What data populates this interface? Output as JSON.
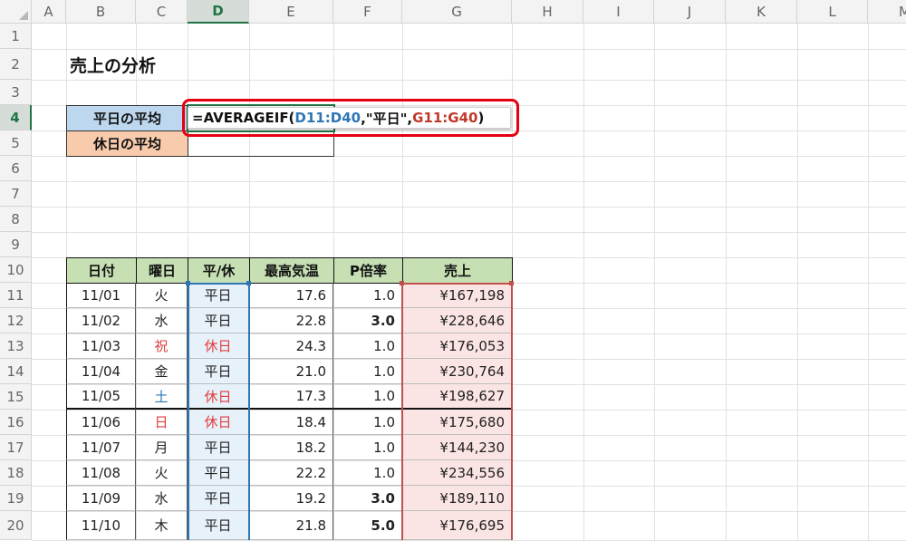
{
  "columns": [
    "A",
    "B",
    "C",
    "D",
    "E",
    "F",
    "G",
    "H",
    "I",
    "J",
    "K",
    "L",
    "M"
  ],
  "rows": [
    "1",
    "2",
    "3",
    "4",
    "5",
    "6",
    "7",
    "8",
    "9",
    "10",
    "11",
    "12",
    "13",
    "14",
    "15",
    "16",
    "17",
    "18",
    "19",
    "20"
  ],
  "title": "売上の分析",
  "summary": {
    "weekday_label": "平日の平均",
    "holiday_label": "休日の平均"
  },
  "formula": {
    "prefix": "=AVERAGEIF(",
    "range1": "D11:D40",
    "sep1": ",\"平日\",",
    "range2": "G11:G40",
    "suffix": ")"
  },
  "table": {
    "headers": [
      "日付",
      "曜日",
      "平/休",
      "最高気温",
      "P倍率",
      "売上"
    ],
    "rows": [
      {
        "date": "11/01",
        "dow": "火",
        "kind": "平日",
        "temp": "17.6",
        "rate": "1.0",
        "sales": "¥167,198"
      },
      {
        "date": "11/02",
        "dow": "水",
        "kind": "平日",
        "temp": "22.8",
        "rate": "3.0",
        "sales": "¥228,646"
      },
      {
        "date": "11/03",
        "dow": "祝",
        "kind": "休日",
        "temp": "24.3",
        "rate": "1.0",
        "sales": "¥176,053"
      },
      {
        "date": "11/04",
        "dow": "金",
        "kind": "平日",
        "temp": "21.0",
        "rate": "1.0",
        "sales": "¥230,764"
      },
      {
        "date": "11/05",
        "dow": "土",
        "kind": "休日",
        "temp": "17.3",
        "rate": "1.0",
        "sales": "¥198,627"
      },
      {
        "date": "11/06",
        "dow": "日",
        "kind": "休日",
        "temp": "18.4",
        "rate": "1.0",
        "sales": "¥175,680"
      },
      {
        "date": "11/07",
        "dow": "月",
        "kind": "平日",
        "temp": "18.2",
        "rate": "1.0",
        "sales": "¥144,230"
      },
      {
        "date": "11/08",
        "dow": "火",
        "kind": "平日",
        "temp": "22.2",
        "rate": "1.0",
        "sales": "¥234,556"
      },
      {
        "date": "11/09",
        "dow": "水",
        "kind": "平日",
        "temp": "19.2",
        "rate": "3.0",
        "sales": "¥189,110"
      },
      {
        "date": "11/10",
        "dow": "木",
        "kind": "平日",
        "temp": "21.8",
        "rate": "5.0",
        "sales": "¥176,695"
      }
    ]
  },
  "colors": {
    "accent": "#217346",
    "highlight_box": "#e60012",
    "range_blue": "#2e75b6",
    "range_red": "#c0504d",
    "header_fill": "#c6e0b4",
    "weekday_fill": "#bdd7ee",
    "holiday_fill": "#f8cbad"
  }
}
